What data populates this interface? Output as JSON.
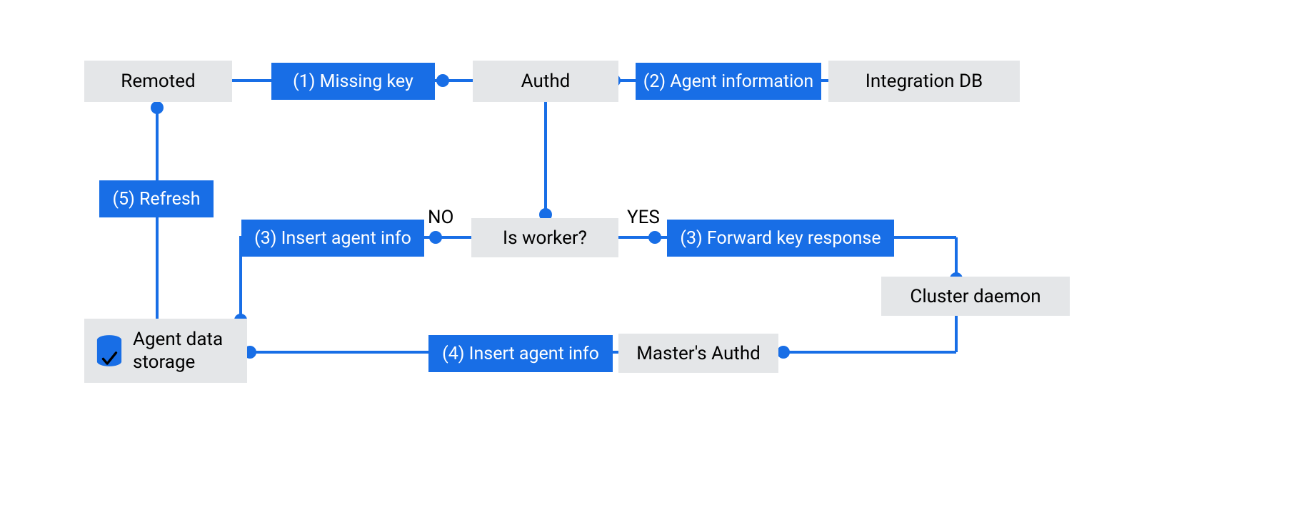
{
  "colors": {
    "accent": "#186ee6",
    "gray": "#e4e6e8",
    "text_dark": "#000000",
    "text_light": "#ffffff"
  },
  "nodes": {
    "remoted": "Remoted",
    "authd": "Authd",
    "integration_db": "Integration DB",
    "is_worker": "Is worker?",
    "cluster_daemon": "Cluster daemon",
    "masters_authd": "Master's Authd",
    "agent_data_storage": "Agent data storage"
  },
  "edges": {
    "missing_key": "(1) Missing key",
    "agent_information": "(2) Agent information",
    "insert_agent_info_a": "(3) Insert agent info",
    "forward_key_response": "(3) Forward key response",
    "insert_agent_info_b": "(4) Insert agent info",
    "refresh": "(5) Refresh"
  },
  "labels": {
    "no": "NO",
    "yes": "YES"
  },
  "icons": {
    "database": "database-icon"
  }
}
